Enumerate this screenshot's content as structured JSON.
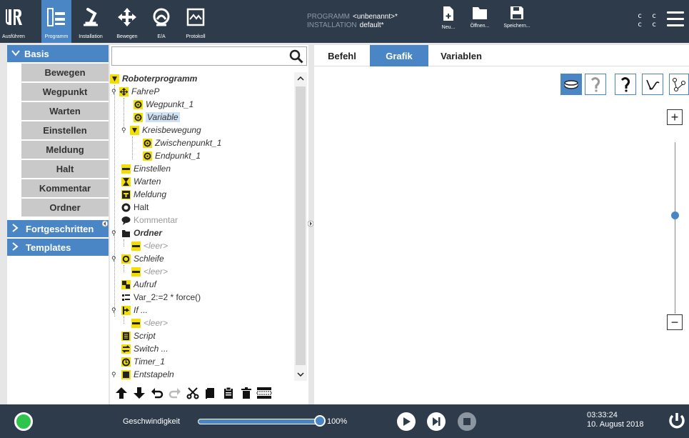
{
  "header": {
    "nav": [
      {
        "label": "Ausführen",
        "icon": "ur-logo-icon"
      },
      {
        "label": "Programm",
        "icon": "program-icon"
      },
      {
        "label": "Installation",
        "icon": "installation-icon"
      },
      {
        "label": "Bewegen",
        "icon": "move-icon"
      },
      {
        "label": "E/A",
        "icon": "io-icon"
      },
      {
        "label": "Protokoll",
        "icon": "log-icon"
      }
    ],
    "program_label": "PROGRAMM",
    "program_value": "<unbenannt>*",
    "installation_label": "INSTALLATION",
    "installation_value": "default*",
    "file_new": "Neu...",
    "file_open": "Öffnen...",
    "file_save": "Speichern...",
    "cc_line1": "c c",
    "cc_line2": "c c"
  },
  "leftnav": {
    "basis": "Basis",
    "items": [
      "Bewegen",
      "Wegpunkt",
      "Warten",
      "Einstellen",
      "Meldung",
      "Halt",
      "Kommentar",
      "Ordner"
    ],
    "advanced": "Fortgeschritten",
    "templates": "Templates"
  },
  "tree": {
    "search_placeholder": "",
    "nodes": [
      {
        "text": "Roboterprogramm",
        "icon": "program-flag-icon"
      },
      {
        "text": "FahreP",
        "icon": "move-icon"
      },
      {
        "text": "Wegpunkt_1",
        "icon": "waypoint-icon"
      },
      {
        "text": "Variable",
        "icon": "waypoint-icon"
      },
      {
        "text": "Kreisbewegung",
        "icon": "circle-move-icon"
      },
      {
        "text": "Zwischenpunkt_1",
        "icon": "waypoint-icon"
      },
      {
        "text": "Endpunkt_1",
        "icon": "waypoint-icon"
      },
      {
        "text": "Einstellen",
        "icon": "set-icon"
      },
      {
        "text": "Warten",
        "icon": "hourglass-icon"
      },
      {
        "text": "Meldung",
        "icon": "message-icon"
      },
      {
        "text": "Halt",
        "icon": "halt-icon"
      },
      {
        "text": "Kommentar",
        "icon": "comment-icon"
      },
      {
        "text": "Ordner",
        "icon": "folder-icon"
      },
      {
        "text": "<leer>",
        "icon": "empty-icon"
      },
      {
        "text": "Schleife",
        "icon": "loop-icon"
      },
      {
        "text": "<leer>",
        "icon": "empty-icon"
      },
      {
        "text": "Aufruf",
        "icon": "call-icon"
      },
      {
        "text": "Var_2:=2 * force()",
        "icon": "assignment-icon"
      },
      {
        "text": "If ...",
        "icon": "if-icon"
      },
      {
        "text": "<leer>",
        "icon": "empty-icon"
      },
      {
        "text": "Script",
        "icon": "script-icon"
      },
      {
        "text": "Switch ...",
        "icon": "switch-icon"
      },
      {
        "text": "Timer_1",
        "icon": "timer-icon"
      },
      {
        "text": "Entstapeln",
        "icon": "pallet-icon"
      }
    ]
  },
  "tabs": [
    "Befehl",
    "Grafik",
    "Variablen"
  ],
  "active_tab": "Grafik",
  "graphics_view_buttons": [
    "base-view-icon",
    "path-view-icon",
    "path-bold-view-icon",
    "tool-path-icon",
    "waypoints-view-icon"
  ],
  "zoom": {
    "plus": "+",
    "minus": "−",
    "level": 0.6
  },
  "footer": {
    "speed_label": "Geschwindigkeit",
    "speed_value": "100%",
    "speed_fraction": 1.0,
    "time": "03:33:24",
    "date": "10. August 2018",
    "status_color": "#2ec54d"
  },
  "colors": {
    "accent": "#4a86c5",
    "header_bg": "#2e3b4a",
    "icon_yellow": "#f2df00"
  }
}
